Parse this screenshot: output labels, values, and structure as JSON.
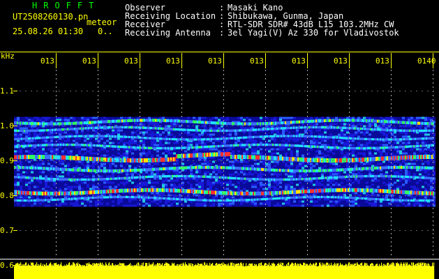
{
  "header": {
    "brand": "HROFFT",
    "filename": "UT2508260130.pn",
    "mode": "meteor",
    "datetime": "25.08.26 01:30",
    "counter": "0..",
    "info": [
      {
        "label": "Observer",
        "value": "Masaki Kano"
      },
      {
        "label": "Receiving Location",
        "value": "Shibukawa, Gunma, Japan"
      },
      {
        "label": "Receiver",
        "value": "RTL-SDR SDR# 43dB L15 103.2MHz CW"
      },
      {
        "label": "Receiving Antenna",
        "value": "3el Yagi(V) Az 330 for Vladivostok"
      }
    ]
  },
  "chart_data": {
    "type": "heatmap",
    "ylabel": "kHz",
    "yticks": [
      {
        "label": "1.1",
        "value": 1.1
      },
      {
        "label": "1.0",
        "value": 1.0
      },
      {
        "label": "0.9",
        "value": 0.9
      },
      {
        "label": "0.8",
        "value": 0.8
      },
      {
        "label": "0.7",
        "value": 0.7
      },
      {
        "label": "0.6",
        "value": 0.6
      }
    ],
    "xticks": [
      "013",
      "013",
      "013",
      "013",
      "013",
      "013",
      "013",
      "013",
      "013",
      "0140"
    ],
    "bands": [
      {
        "freq": 1.01,
        "strength": 0.55
      },
      {
        "freq": 0.99,
        "strength": 0.35
      },
      {
        "freq": 0.965,
        "strength": 0.3
      },
      {
        "freq": 0.94,
        "strength": 0.35
      },
      {
        "freq": 0.905,
        "strength": 1.0
      },
      {
        "freq": 0.875,
        "strength": 0.55
      },
      {
        "freq": 0.85,
        "strength": 0.35
      },
      {
        "freq": 0.81,
        "strength": 0.85
      },
      {
        "freq": 0.79,
        "strength": 0.3
      }
    ],
    "colors": {
      "background": "#000000",
      "noise": "#1010c8",
      "axis": "#ffff00",
      "level": "#ffff00"
    }
  }
}
